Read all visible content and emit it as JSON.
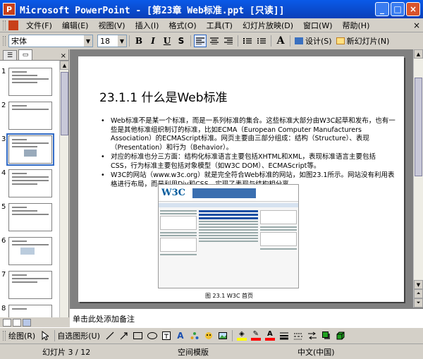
{
  "window": {
    "title": "Microsoft PowerPoint - [第23章  Web标准.ppt [只读]]",
    "app_icon": "P",
    "controls": [
      "_",
      "□",
      "×"
    ]
  },
  "menu": {
    "items": [
      "文件(F)",
      "编辑(E)",
      "视图(V)",
      "插入(I)",
      "格式(O)",
      "工具(T)",
      "幻灯片放映(D)",
      "窗口(W)",
      "帮助(H)"
    ],
    "close": "×"
  },
  "format_toolbar": {
    "font": "宋体",
    "size": "18",
    "bold": "B",
    "italic": "I",
    "underline": "U",
    "strike": "S",
    "design_label": "设计(S)",
    "new_slide_label": "新幻灯片(N)"
  },
  "panel": {
    "tabs": [
      "☰",
      "▭"
    ],
    "close": "×",
    "thumbnails": [
      "1",
      "2",
      "3",
      "4",
      "5",
      "6",
      "7",
      "8"
    ],
    "selected": 3
  },
  "slide": {
    "title": "23.1.1  什么是Web标准",
    "bullets": [
      "Web标准不是某一个标准，而是一系列标准的集合。这些标准大部分由W3C起草和发布，也有一些是其他标准组织制订的标准，比如ECMA（European Computer Manufacturers Association）的ECMAScript标准。网页主要由三部分组成：结构（Structure）、表现（Presentation）和行为（Behavior）。",
      "对应的标准也分三方面：结构化标准语言主要包括XHTML和XML，表现标准语言主要包括CSS，行为标准主要包括对象模型（如W3C DOM）、ECMAScript等。",
      "W3C的网站（www.w3c.org）就是完全符合Web标准的网站，如图23.1所示。网站没有利用表格进行布局，而是利用Div和CSS，实现了表现与结构相分离。"
    ],
    "figure_logo": "W3C",
    "figure_caption": "图 23.1   W3C 首页"
  },
  "notes": {
    "placeholder": "单击此处添加备注"
  },
  "draw_toolbar": {
    "draw_label": "绘图(R)",
    "autoshapes_label": "自选图形(U)",
    "colors": {
      "fill": "#ffff00",
      "line": "#ff0000",
      "font": "#ff0000"
    }
  },
  "status": {
    "slide_position": "幻灯片 3 / 12",
    "design": "空间模版",
    "language": "中文(中国)"
  }
}
